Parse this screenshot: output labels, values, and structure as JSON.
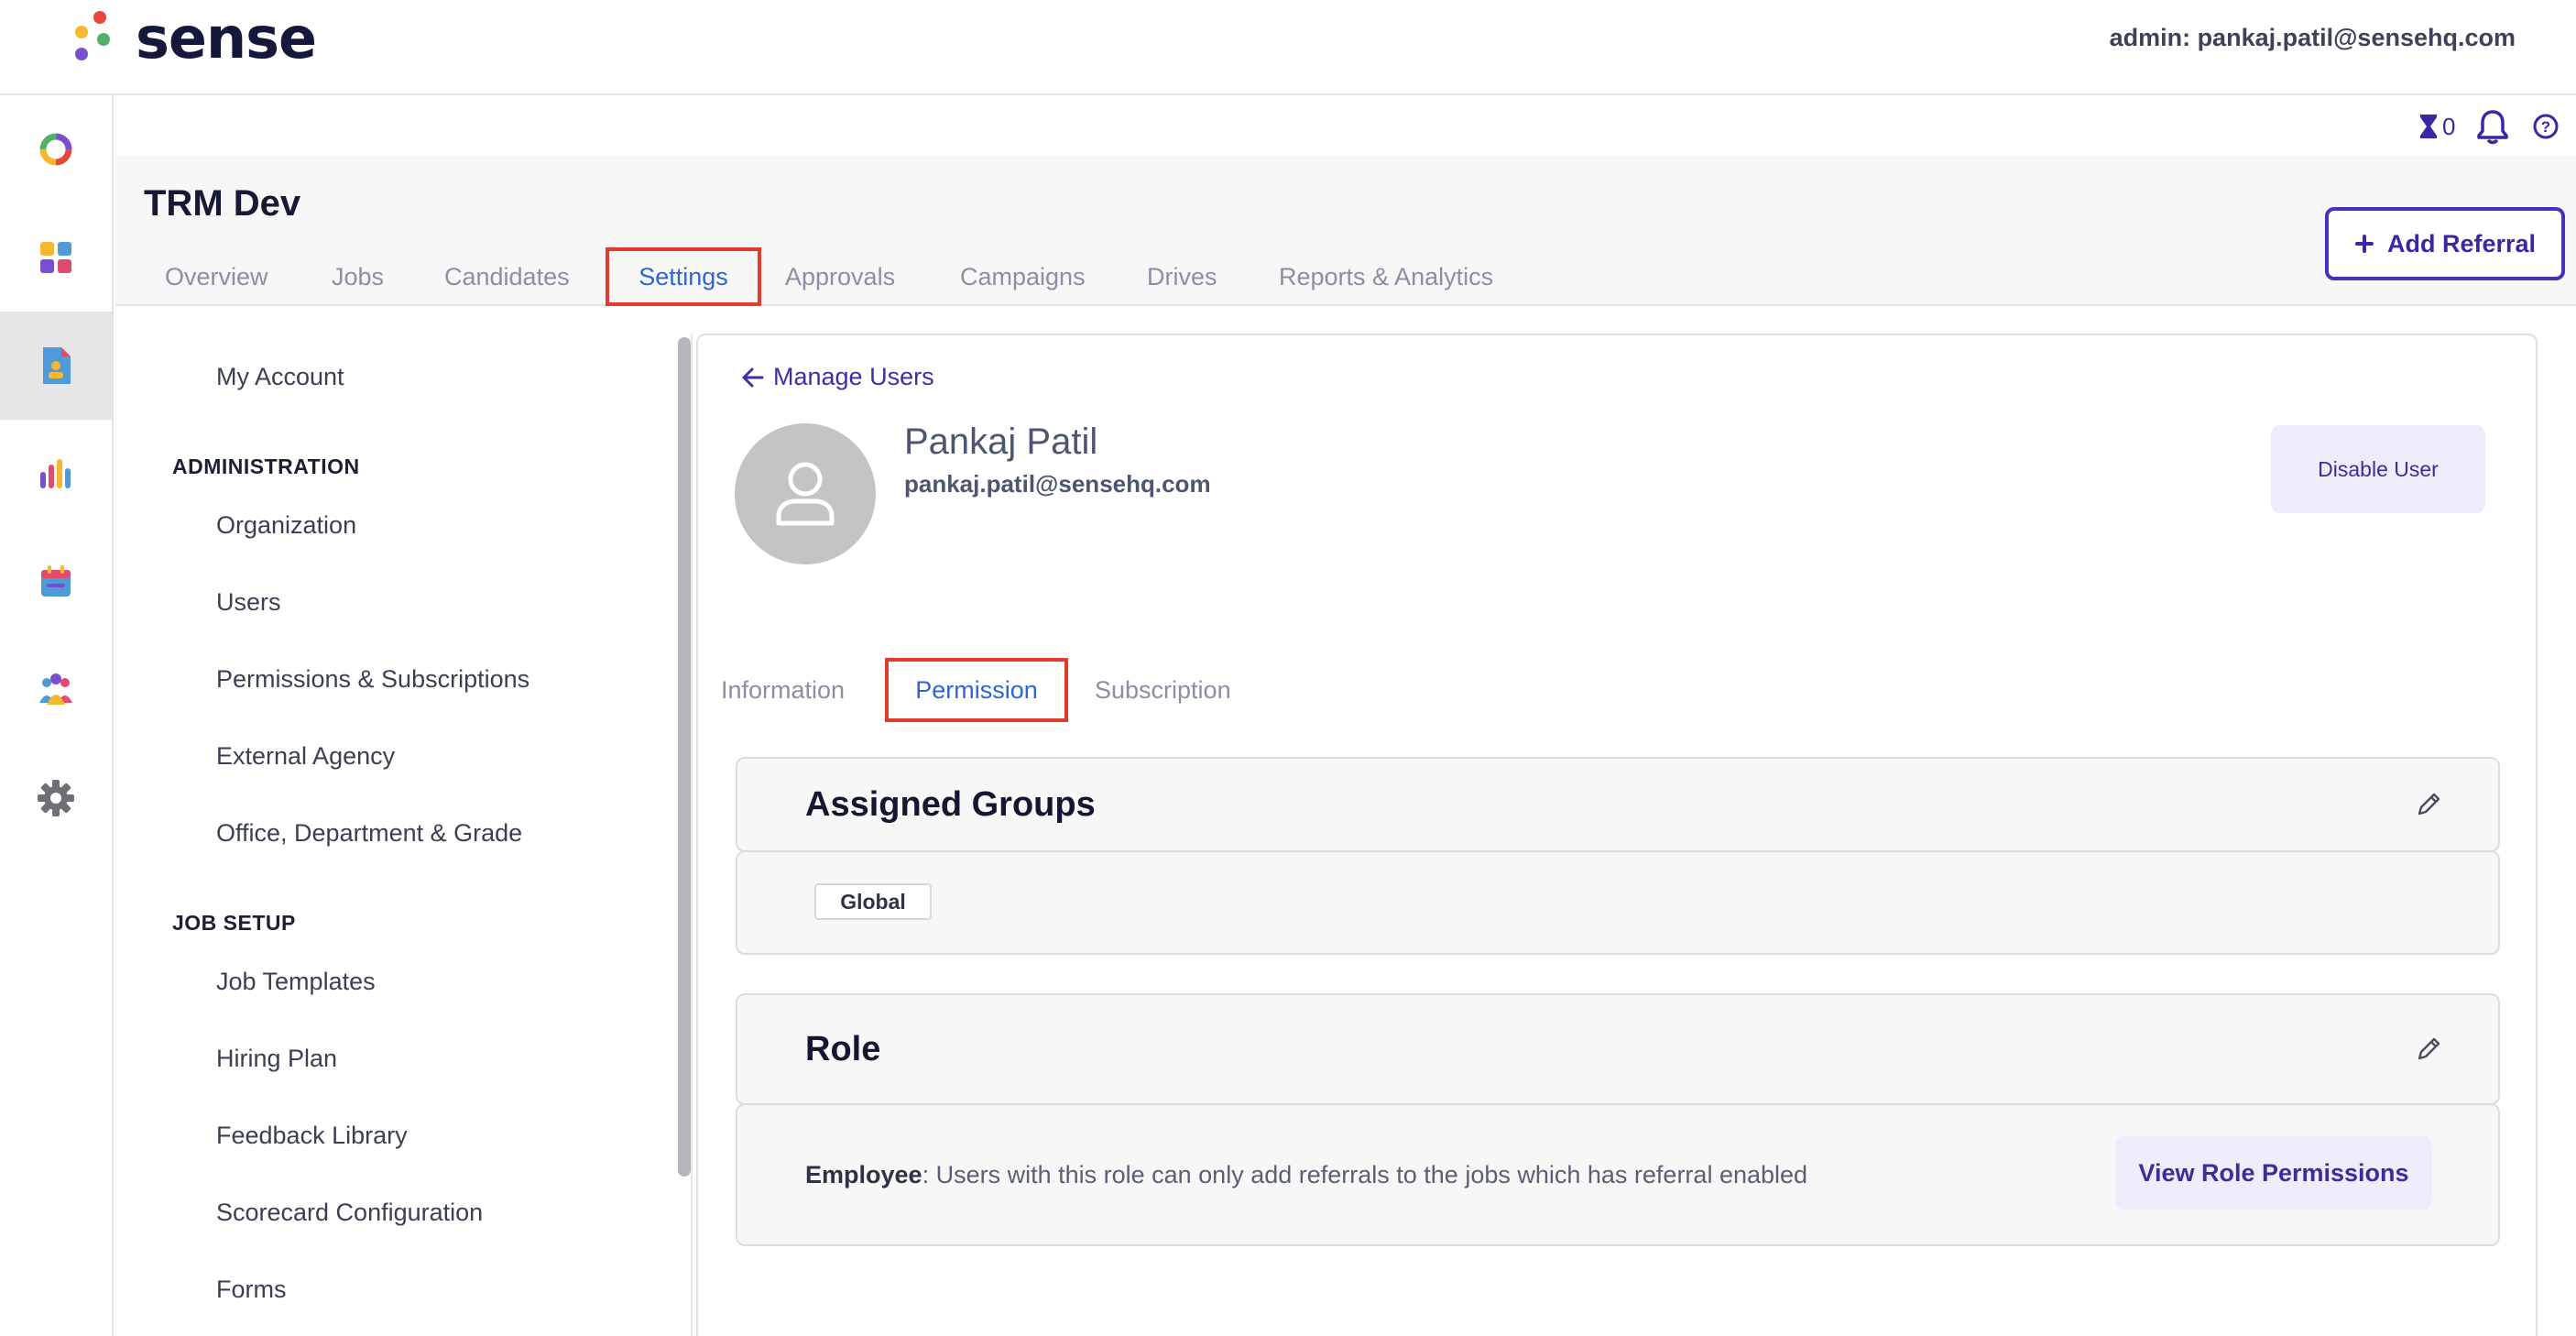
{
  "brand": {
    "name": "sense"
  },
  "topbar": {
    "admin_label": "admin: pankaj.patil@sensehq.com"
  },
  "utility": {
    "queue_count": "0"
  },
  "project": {
    "title": "TRM Dev"
  },
  "tabs": [
    "Overview",
    "Jobs",
    "Candidates",
    "Settings",
    "Approvals",
    "Campaigns",
    "Drives",
    "Reports & Analytics"
  ],
  "active_tab": "Settings",
  "add_referral": {
    "label": "Add Referral"
  },
  "sidebar": {
    "my_account": "My Account",
    "administration_heading": "ADMINISTRATION",
    "administration": [
      "Organization",
      "Users",
      "Permissions & Subscriptions",
      "External Agency",
      "Office, Department & Grade"
    ],
    "job_setup_heading": "JOB SETUP",
    "job_setup": [
      "Job Templates",
      "Hiring Plan",
      "Feedback Library",
      "Scorecard Configuration",
      "Forms"
    ]
  },
  "user": {
    "back_label": "Manage Users",
    "name": "Pankaj Patil",
    "email": "pankaj.patil@sensehq.com",
    "disable_label": "Disable User"
  },
  "subtabs": [
    "Information",
    "Permission",
    "Subscription"
  ],
  "active_subtab": "Permission",
  "assigned_groups": {
    "title": "Assigned Groups",
    "groups": [
      "Global"
    ]
  },
  "role": {
    "title": "Role",
    "name": "Employee",
    "description": ": Users with this role can only add referrals to the jobs which has referral enabled",
    "view_label": "View Role Permissions"
  },
  "colors": {
    "accent": "#3a27a6",
    "active_tab_text": "#2f64d8",
    "highlight_box": "#e23b2e",
    "logo_dots": [
      "#e8473a",
      "#f5b82e",
      "#52b069",
      "#7a4fcf"
    ]
  }
}
